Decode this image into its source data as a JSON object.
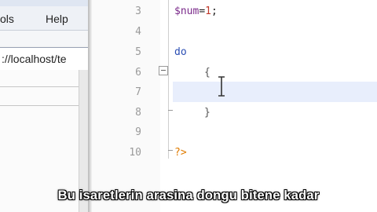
{
  "browser": {
    "menu": {
      "tools_label": "ols",
      "help_label": "Help"
    },
    "address": {
      "value": "://localhost/te"
    }
  },
  "editor": {
    "lines": [
      {
        "num": "3",
        "var": "$num",
        "op": "=",
        "num_val": "1",
        "end": ";"
      },
      {
        "num": "4"
      },
      {
        "num": "5",
        "keyword": "do"
      },
      {
        "num": "6",
        "brace": "{"
      },
      {
        "num": "7"
      },
      {
        "num": "8",
        "brace": "}"
      },
      {
        "num": "9"
      },
      {
        "num": "10",
        "tag": "?>"
      }
    ]
  },
  "subtitle": {
    "text": "Bu isaretlerin arasina dongu bitene kadar"
  },
  "colors": {
    "keyword": "#2a4db3",
    "variable": "#7a2a8a",
    "number": "#c0392b",
    "php_tag": "#e07b00",
    "current_line": "#e8eefc"
  },
  "icons": [
    "fold-collapse-icon",
    "text-cursor-icon"
  ]
}
